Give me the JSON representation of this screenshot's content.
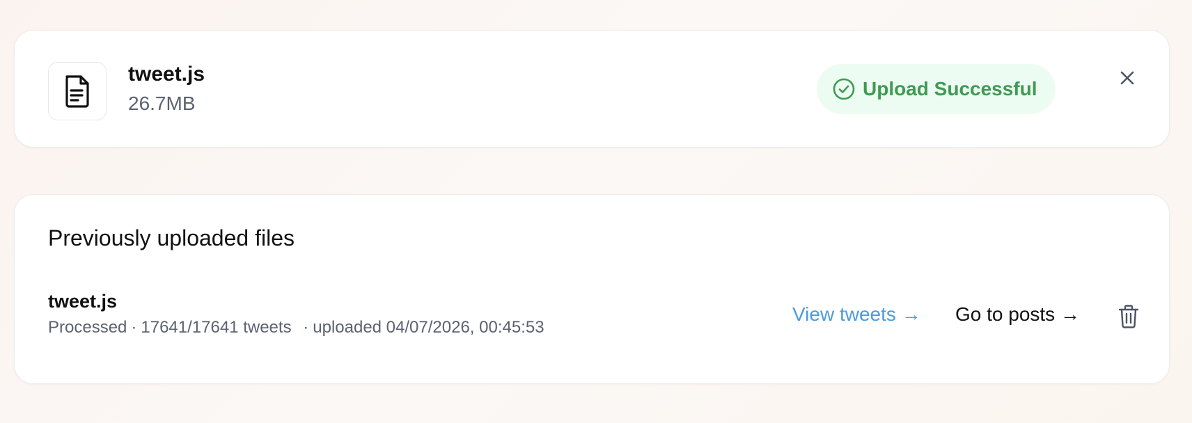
{
  "upload": {
    "file_name": "tweet.js",
    "file_size": "26.7MB",
    "status_label": "Upload Successful",
    "status_color": "#3f9a52",
    "status_bg": "#edfcf2",
    "file_icon": "document-icon",
    "status_icon": "check-circle-icon",
    "close_icon": "close-icon"
  },
  "history": {
    "title": "Previously uploaded files",
    "rows": [
      {
        "file_name": "tweet.js",
        "status": "Processed",
        "sep1": "·",
        "progress": "17641/17641 tweets",
        "sep2": "·",
        "uploaded": "uploaded 04/07/2026, 00:45:53",
        "view_label": "View tweets →",
        "posts_label": "Go to posts →",
        "delete_icon": "trash-icon",
        "link_color": "#4a9be0"
      }
    ]
  }
}
